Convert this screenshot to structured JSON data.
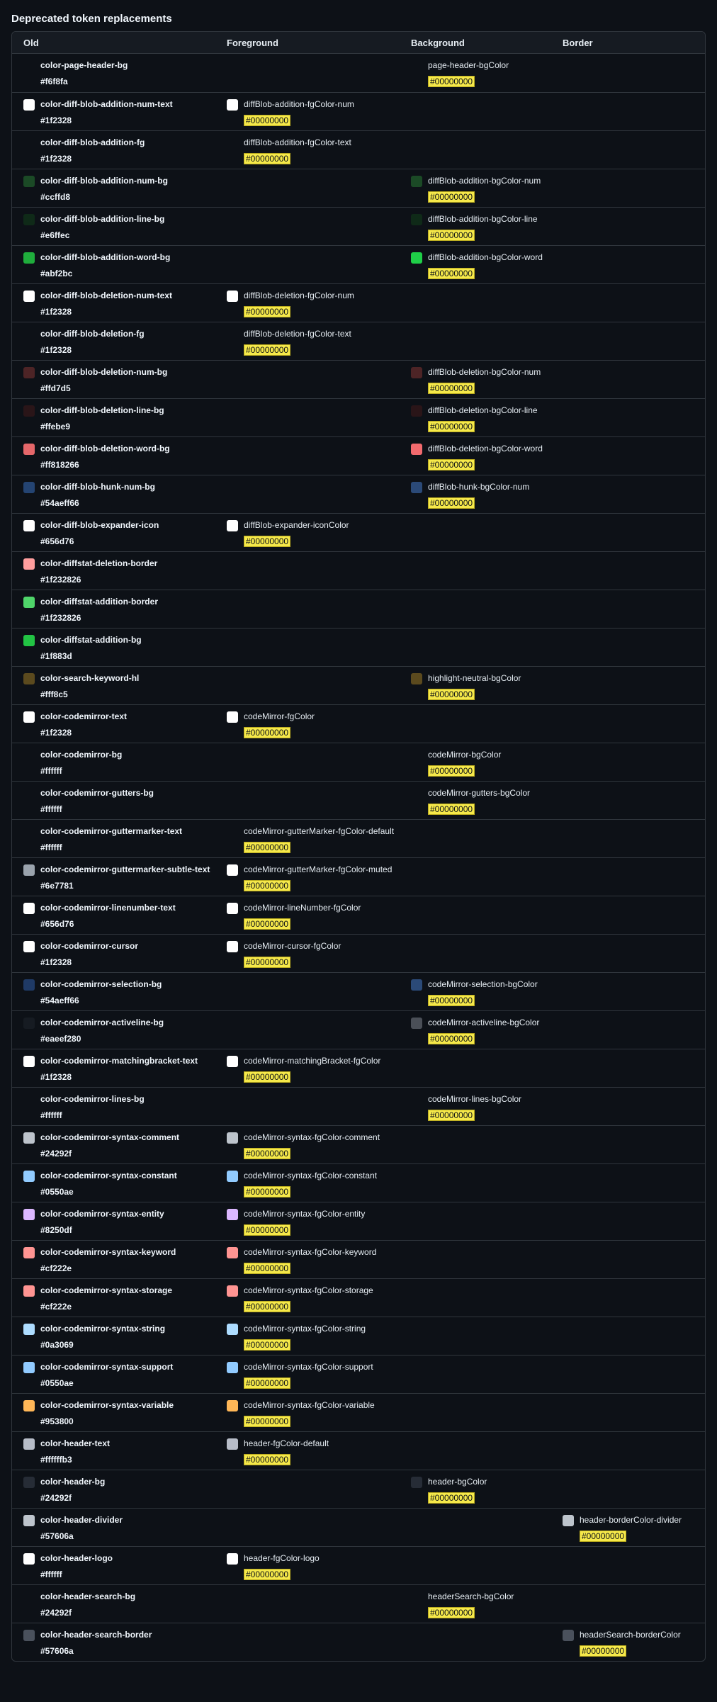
{
  "page_title": "Deprecated token replacements",
  "headers": {
    "old": "Old",
    "foreground": "Foreground",
    "background": "Background",
    "border": "Border"
  },
  "rows": [
    {
      "old": "color-page-header-bg",
      "hex": "#f6f8fa",
      "swatch": "",
      "col": "bg",
      "token": "page-header-bgColor",
      "token_swatch": "",
      "value": "#00000000"
    },
    {
      "old": "color-diff-blob-addition-num-text",
      "hex": "#1f2328",
      "swatch": "#ffffff",
      "col": "fg",
      "token": "diffBlob-addition-fgColor-num",
      "token_swatch": "#ffffff",
      "value": "#00000000"
    },
    {
      "old": "color-diff-blob-addition-fg",
      "hex": "#1f2328",
      "swatch": "",
      "col": "fg",
      "token": "diffBlob-addition-fgColor-text",
      "token_swatch": "",
      "value": "#00000000"
    },
    {
      "old": "color-diff-blob-addition-num-bg",
      "hex": "#ccffd8",
      "swatch": "#1b4a26",
      "col": "bg",
      "token": "diffBlob-addition-bgColor-num",
      "token_swatch": "#1b4a26",
      "value": "#00000000"
    },
    {
      "old": "color-diff-blob-addition-line-bg",
      "hex": "#e6ffec",
      "swatch": "#0f2a18",
      "col": "bg",
      "token": "diffBlob-addition-bgColor-line",
      "token_swatch": "#0f2a18",
      "value": "#00000000"
    },
    {
      "old": "color-diff-blob-addition-word-bg",
      "hex": "#abf2bc",
      "swatch": "#1fad3c",
      "col": "bg",
      "token": "diffBlob-addition-bgColor-word",
      "token_swatch": "#1fcf48",
      "value": "#00000000"
    },
    {
      "old": "color-diff-blob-deletion-num-text",
      "hex": "#1f2328",
      "swatch": "#ffffff",
      "col": "fg",
      "token": "diffBlob-deletion-fgColor-num",
      "token_swatch": "#ffffff",
      "value": "#00000000"
    },
    {
      "old": "color-diff-blob-deletion-fg",
      "hex": "#1f2328",
      "swatch": "",
      "col": "fg",
      "token": "diffBlob-deletion-fgColor-text",
      "token_swatch": "",
      "value": "#00000000"
    },
    {
      "old": "color-diff-blob-deletion-num-bg",
      "hex": "#ffd7d5",
      "swatch": "#4d2426",
      "col": "bg",
      "token": "diffBlob-deletion-bgColor-num",
      "token_swatch": "#4d2426",
      "value": "#00000000"
    },
    {
      "old": "color-diff-blob-deletion-line-bg",
      "hex": "#ffebe9",
      "swatch": "#2a1518",
      "col": "bg",
      "token": "diffBlob-deletion-bgColor-line",
      "token_swatch": "#2a1518",
      "value": "#00000000"
    },
    {
      "old": "color-diff-blob-deletion-word-bg",
      "hex": "#ff818266",
      "swatch": "#e5676a",
      "col": "bg",
      "token": "diffBlob-deletion-bgColor-word",
      "token_swatch": "#f26a6e",
      "value": "#00000000"
    },
    {
      "old": "color-diff-blob-hunk-num-bg",
      "hex": "#54aeff66",
      "swatch": "#244472",
      "col": "bg",
      "token": "diffBlob-hunk-bgColor-num",
      "token_swatch": "#2b4a78",
      "value": "#00000000"
    },
    {
      "old": "color-diff-blob-expander-icon",
      "hex": "#656d76",
      "swatch": "#ffffff",
      "col": "fg",
      "token": "diffBlob-expander-iconColor",
      "token_swatch": "#ffffff",
      "value": "#00000000"
    },
    {
      "old": "color-diffstat-deletion-border",
      "hex": "#1f232826",
      "swatch": "#ff9e9e",
      "col": "",
      "token": "",
      "token_swatch": "",
      "value": ""
    },
    {
      "old": "color-diffstat-addition-border",
      "hex": "#1f232826",
      "swatch": "#4fd56a",
      "col": "",
      "token": "",
      "token_swatch": "",
      "value": ""
    },
    {
      "old": "color-diffstat-addition-bg",
      "hex": "#1f883d",
      "swatch": "#22c444",
      "col": "",
      "token": "",
      "token_swatch": "",
      "value": ""
    },
    {
      "old": "color-search-keyword-hl",
      "hex": "#fff8c5",
      "swatch": "#5b4a1e",
      "col": "bg",
      "token": "highlight-neutral-bgColor",
      "token_swatch": "#5b4a1e",
      "value": "#00000000"
    },
    {
      "old": "color-codemirror-text",
      "hex": "#1f2328",
      "swatch": "#ffffff",
      "col": "fg",
      "token": "codeMirror-fgColor",
      "token_swatch": "#ffffff",
      "value": "#00000000"
    },
    {
      "old": "color-codemirror-bg",
      "hex": "#ffffff",
      "swatch": "",
      "col": "bg",
      "token": "codeMirror-bgColor",
      "token_swatch": "",
      "value": "#00000000"
    },
    {
      "old": "color-codemirror-gutters-bg",
      "hex": "#ffffff",
      "swatch": "",
      "col": "bg",
      "token": "codeMirror-gutters-bgColor",
      "token_swatch": "",
      "value": "#00000000"
    },
    {
      "old": "color-codemirror-guttermarker-text",
      "hex": "#ffffff",
      "swatch": "",
      "col": "fg",
      "token": "codeMirror-gutterMarker-fgColor-default",
      "token_swatch": "",
      "value": "#00000000"
    },
    {
      "old": "color-codemirror-guttermarker-subtle-text",
      "hex": "#6e7781",
      "swatch": "#9aa3ad",
      "col": "fg",
      "token": "codeMirror-gutterMarker-fgColor-muted",
      "token_swatch": "#ffffff",
      "value": "#00000000"
    },
    {
      "old": "color-codemirror-linenumber-text",
      "hex": "#656d76",
      "swatch": "#ffffff",
      "col": "fg",
      "token": "codeMirror-lineNumber-fgColor",
      "token_swatch": "#ffffff",
      "value": "#00000000"
    },
    {
      "old": "color-codemirror-cursor",
      "hex": "#1f2328",
      "swatch": "#ffffff",
      "col": "fg",
      "token": "codeMirror-cursor-fgColor",
      "token_swatch": "#ffffff",
      "value": "#00000000"
    },
    {
      "old": "color-codemirror-selection-bg",
      "hex": "#54aeff66",
      "swatch": "#1f3a66",
      "col": "bg",
      "token": "codeMirror-selection-bgColor",
      "token_swatch": "#2b4a78",
      "value": "#00000000"
    },
    {
      "old": "color-codemirror-activeline-bg",
      "hex": "#eaeef280",
      "swatch": "#161b22",
      "col": "bg",
      "token": "codeMirror-activeline-bgColor",
      "token_swatch": "#4a4f57",
      "value": "#00000000"
    },
    {
      "old": "color-codemirror-matchingbracket-text",
      "hex": "#1f2328",
      "swatch": "#ffffff",
      "col": "fg",
      "token": "codeMirror-matchingBracket-fgColor",
      "token_swatch": "#ffffff",
      "value": "#00000000"
    },
    {
      "old": "color-codemirror-lines-bg",
      "hex": "#ffffff",
      "swatch": "",
      "col": "bg",
      "token": "codeMirror-lines-bgColor",
      "token_swatch": "",
      "value": "#00000000"
    },
    {
      "old": "color-codemirror-syntax-comment",
      "hex": "#24292f",
      "swatch": "#bdc4cc",
      "col": "fg",
      "token": "codeMirror-syntax-fgColor-comment",
      "token_swatch": "#bdc4cc",
      "value": "#00000000"
    },
    {
      "old": "color-codemirror-syntax-constant",
      "hex": "#0550ae",
      "swatch": "#91cbff",
      "col": "fg",
      "token": "codeMirror-syntax-fgColor-constant",
      "token_swatch": "#91cbff",
      "value": "#00000000"
    },
    {
      "old": "color-codemirror-syntax-entity",
      "hex": "#8250df",
      "swatch": "#dbb7ff",
      "col": "fg",
      "token": "codeMirror-syntax-fgColor-entity",
      "token_swatch": "#dbb7ff",
      "value": "#00000000"
    },
    {
      "old": "color-codemirror-syntax-keyword",
      "hex": "#cf222e",
      "swatch": "#ff9492",
      "col": "fg",
      "token": "codeMirror-syntax-fgColor-keyword",
      "token_swatch": "#ff9492",
      "value": "#00000000"
    },
    {
      "old": "color-codemirror-syntax-storage",
      "hex": "#cf222e",
      "swatch": "#ff9492",
      "col": "fg",
      "token": "codeMirror-syntax-fgColor-storage",
      "token_swatch": "#ff9492",
      "value": "#00000000"
    },
    {
      "old": "color-codemirror-syntax-string",
      "hex": "#0a3069",
      "swatch": "#addcff",
      "col": "fg",
      "token": "codeMirror-syntax-fgColor-string",
      "token_swatch": "#addcff",
      "value": "#00000000"
    },
    {
      "old": "color-codemirror-syntax-support",
      "hex": "#0550ae",
      "swatch": "#91cbff",
      "col": "fg",
      "token": "codeMirror-syntax-fgColor-support",
      "token_swatch": "#91cbff",
      "value": "#00000000"
    },
    {
      "old": "color-codemirror-syntax-variable",
      "hex": "#953800",
      "swatch": "#ffb757",
      "col": "fg",
      "token": "codeMirror-syntax-fgColor-variable",
      "token_swatch": "#ffb757",
      "value": "#00000000"
    },
    {
      "old": "color-header-text",
      "hex": "#ffffffb3",
      "swatch": "#b7bdc8",
      "col": "fg",
      "token": "header-fgColor-default",
      "token_swatch": "#b7bdc8",
      "value": "#00000000"
    },
    {
      "old": "color-header-bg",
      "hex": "#24292f",
      "swatch": "#262c36",
      "col": "bg",
      "token": "header-bgColor",
      "token_swatch": "#262c36",
      "value": "#00000000"
    },
    {
      "old": "color-header-divider",
      "hex": "#57606a",
      "swatch": "#bdc4cc",
      "col": "border",
      "token": "header-borderColor-divider",
      "token_swatch": "#bdc4cc",
      "value": "#00000000"
    },
    {
      "old": "color-header-logo",
      "hex": "#ffffff",
      "swatch": "#ffffff",
      "col": "fg",
      "token": "header-fgColor-logo",
      "token_swatch": "#ffffff",
      "value": "#00000000"
    },
    {
      "old": "color-header-search-bg",
      "hex": "#24292f",
      "swatch": "",
      "col": "bg",
      "token": "headerSearch-bgColor",
      "token_swatch": "",
      "value": "#00000000"
    },
    {
      "old": "color-header-search-border",
      "hex": "#57606a",
      "swatch": "#4a515c",
      "col": "border",
      "token": "headerSearch-borderColor",
      "token_swatch": "#4a515c",
      "value": "#00000000"
    }
  ]
}
